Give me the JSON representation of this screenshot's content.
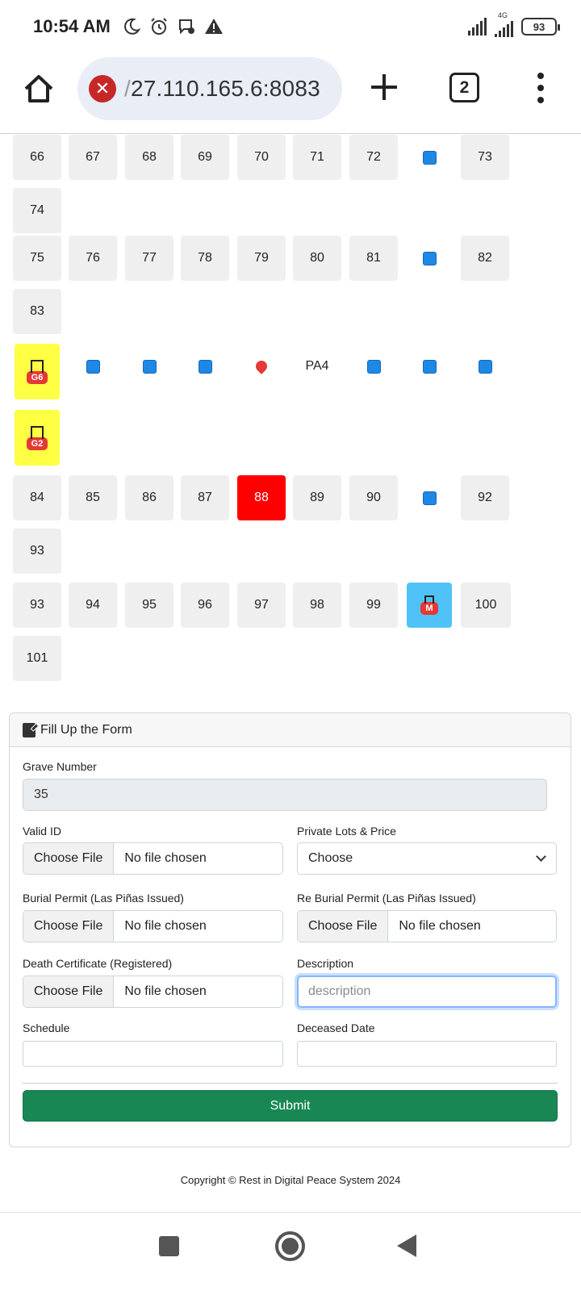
{
  "status_bar": {
    "time": "10:54 AM",
    "network": "4G",
    "battery": "93",
    "icons": [
      "moon-icon",
      "alarm-icon",
      "messenger-icon",
      "warning-icon",
      "signal-icon"
    ]
  },
  "browser": {
    "url_prefix": "/",
    "url": "27.110.165.6:8083",
    "tab_count": "2",
    "icons": [
      "home-icon",
      "connection-error-icon",
      "plus-icon",
      "tabs-icon",
      "more-icon"
    ]
  },
  "grid": {
    "rows": [
      [
        "66",
        "67",
        "68",
        "69",
        "70",
        "71",
        "72",
        "[blue]",
        "73"
      ],
      [
        "74"
      ],
      [
        "75",
        "76",
        "77",
        "78",
        "79",
        "80",
        "81",
        "[blue]",
        "82"
      ],
      [
        "83"
      ],
      [
        "[G6]",
        "[blue]",
        "[blue]",
        "[blue]",
        "[pin]",
        "PA4",
        "[blue]",
        "[blue]",
        "[blue]"
      ],
      [
        "[G2]"
      ],
      [
        "84",
        "85",
        "86",
        "87",
        "88",
        "89",
        "90",
        "[blue]",
        "92"
      ],
      [
        "93"
      ],
      [
        "93",
        "94",
        "95",
        "96",
        "97",
        "98",
        "99",
        "[M]",
        "100"
      ],
      [
        "101"
      ]
    ],
    "occupied_lot": "88",
    "gate_labels": [
      "G6",
      "G2"
    ],
    "marker_label": "M",
    "pathway_label": "PA4",
    "colors": {
      "occupied": "#ff0000",
      "gate": "#ffff44",
      "marker": "#4fc3f7",
      "block": "#1e88e5",
      "badge": "#e53935"
    }
  },
  "form": {
    "title": "Fill Up the Form",
    "grave_number_label": "Grave Number",
    "grave_number_value": "35",
    "valid_id_label": "Valid ID",
    "private_lots_label": "Private Lots & Price",
    "private_lots_value": "Choose",
    "burial_permit_label": "Burial Permit (Las Piñas Issued)",
    "reburial_permit_label": "Re Burial Permit (Las Piñas Issued)",
    "death_cert_label": "Death Certificate (Registered)",
    "description_label": "Description",
    "description_placeholder": "description",
    "schedule_label": "Schedule",
    "deceased_date_label": "Deceased Date",
    "choose_file": "Choose File",
    "no_file": "No file chosen",
    "submit": "Submit"
  },
  "footer": {
    "copyright": "Copyright © Rest in Digital Peace System 2024"
  },
  "colors": {
    "submit": "#198754",
    "focus": "#86b7fe",
    "error": "#c62828"
  }
}
